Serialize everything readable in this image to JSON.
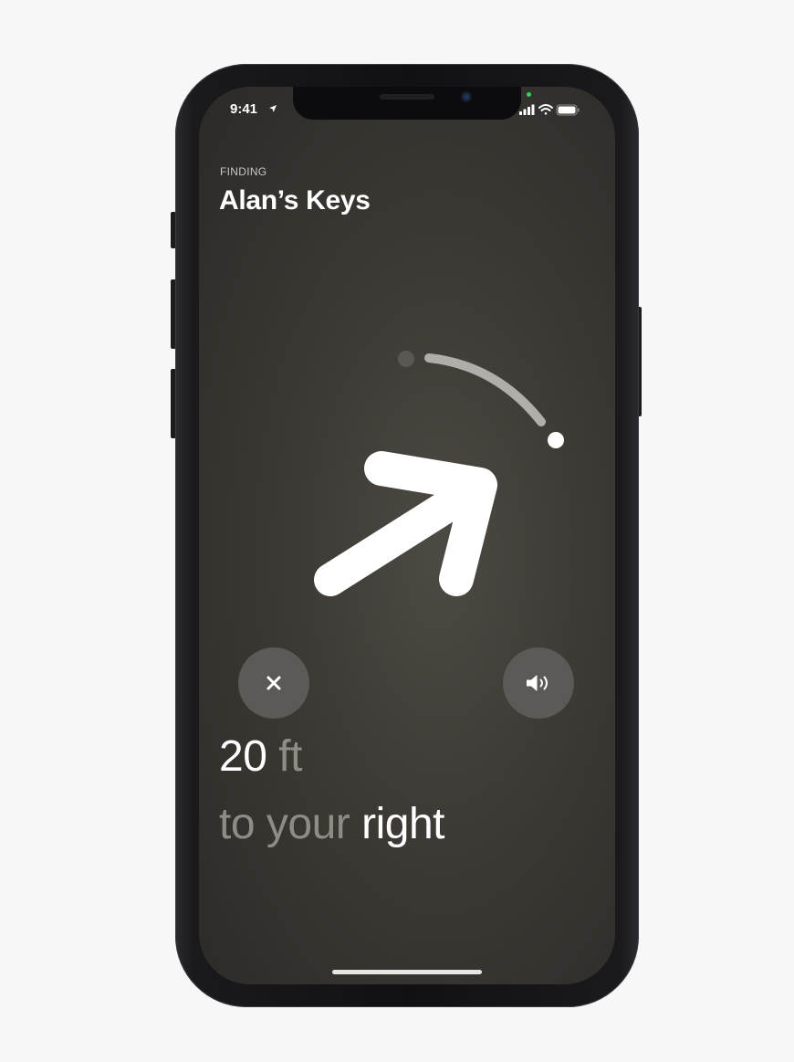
{
  "status_bar": {
    "time": "9:41",
    "icons": [
      "location-arrow-icon",
      "cellular-signal-icon",
      "wifi-icon",
      "battery-icon"
    ]
  },
  "header": {
    "label": "FINDING",
    "title": "Alan’s Keys"
  },
  "guidance": {
    "distance_value": "20",
    "distance_unit": "ft",
    "direction_prefix": "to your",
    "direction_word": "right",
    "arrow_icon": "direction-arrow-icon"
  },
  "controls": {
    "close_icon": "close-icon",
    "sound_icon": "speaker-icon"
  },
  "colors": {
    "screen_bg": "#3e3b36",
    "text_primary": "#ffffff",
    "text_secondary": "#8f8c86",
    "button_bg": "#5c5a56"
  }
}
